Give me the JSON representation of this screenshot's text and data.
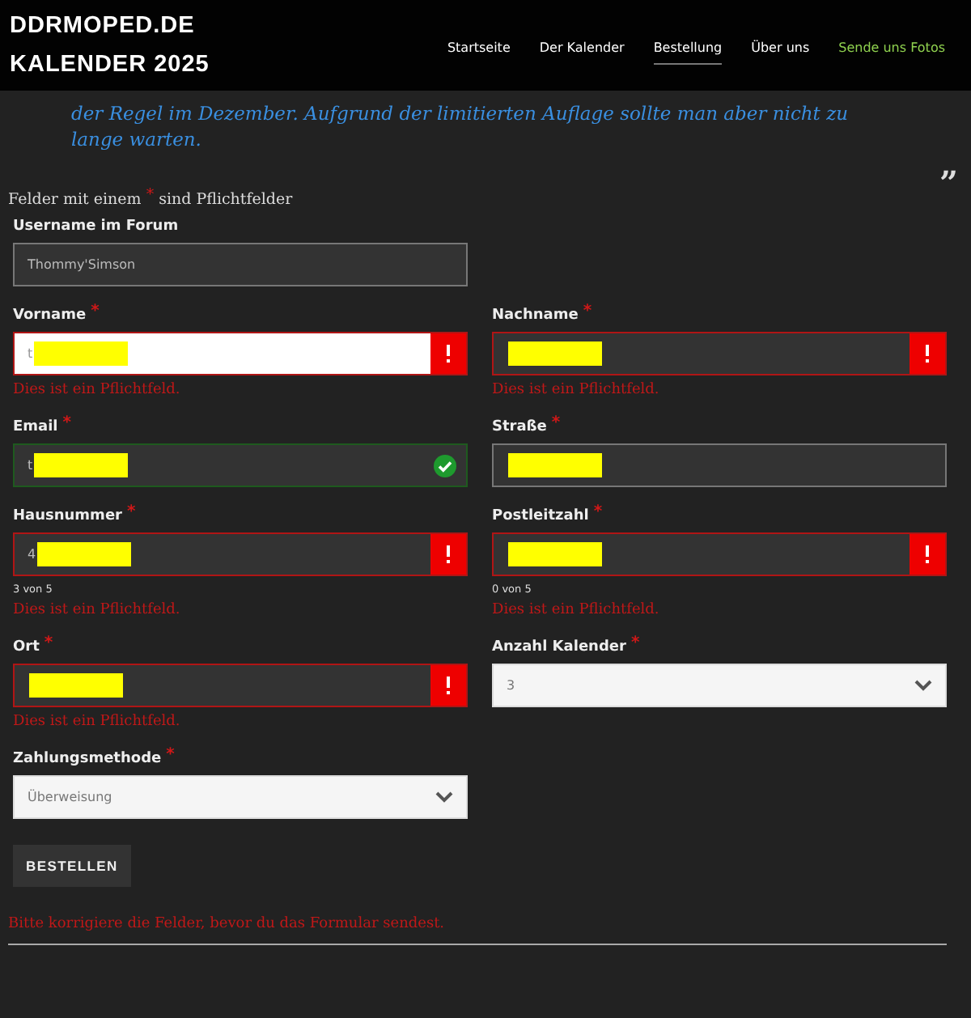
{
  "header": {
    "logo_lines": [
      "DDRMOPED.DE",
      "KALENDER 2025"
    ],
    "nav": [
      {
        "label": "Startseite",
        "selected": false,
        "kind": "link"
      },
      {
        "label": "Der Kalender",
        "selected": false,
        "kind": "link"
      },
      {
        "label": "Bestellung",
        "selected": true,
        "kind": "link"
      },
      {
        "label": "Über uns",
        "selected": false,
        "kind": "link"
      },
      {
        "label": "Sende uns Fotos",
        "selected": false,
        "kind": "cta"
      }
    ]
  },
  "quote": {
    "lines": [
      "der Regel im Dezember. Aufgrund der limitierten Auflage sollte man aber nicht zu",
      "lange warten."
    ],
    "mark": "”"
  },
  "form": {
    "note_before": "Felder mit einem",
    "note_star": "*",
    "note_after": "sind Pflichtfelder",
    "rows": [
      [
        {
          "label": "Username im Forum",
          "required": false,
          "kind": "text",
          "value": "Thommy'Simson",
          "invalid": false,
          "valid": false,
          "redacted": false
        }
      ],
      [
        {
          "label": "Vorname",
          "required": true,
          "kind": "text",
          "value": "t",
          "invalid": true,
          "valid": false,
          "redacted": true,
          "focused": true,
          "error": "Dies ist ein Pflichtfeld."
        },
        {
          "label": "Nachname",
          "required": true,
          "kind": "text",
          "invalid": true,
          "valid": false,
          "redacted": true,
          "focused": false,
          "error": "Dies ist ein Pflichtfeld."
        }
      ],
      [
        {
          "label": "Email",
          "required": true,
          "kind": "text",
          "value": "t",
          "invalid": false,
          "valid": true,
          "redacted": true
        },
        {
          "label": "Straße",
          "required": true,
          "kind": "text",
          "invalid": false,
          "valid": false,
          "redacted": true
        }
      ],
      [
        {
          "label": "Hausnummer",
          "required": true,
          "kind": "text",
          "value": "4",
          "invalid": true,
          "valid": false,
          "redacted": true,
          "focused": false,
          "counter": "3 von 5",
          "error": "Dies ist ein Pflichtfeld."
        },
        {
          "label": "Postleitzahl",
          "required": true,
          "kind": "text",
          "invalid": true,
          "valid": false,
          "redacted": true,
          "focused": false,
          "counter": "0 von 5",
          "error": "Dies ist ein Pflichtfeld."
        }
      ],
      [
        {
          "label": "Ort",
          "required": true,
          "kind": "text",
          "invalid": true,
          "valid": false,
          "redacted": true,
          "focused": false,
          "error": "Dies ist ein Pflichtfeld."
        },
        {
          "label": "Anzahl Kalender",
          "required": true,
          "kind": "select",
          "value": "3",
          "invalid": false,
          "valid": false,
          "redacted": false
        }
      ],
      [
        {
          "label": "Zahlungsmethode",
          "required": true,
          "kind": "select",
          "value": "Überweisung",
          "invalid": false,
          "valid": false,
          "redacted": false
        }
      ]
    ],
    "submit": "BESTELLEN",
    "form_error": "Bitte korrigiere die Felder, bevor du das Formular sendest."
  }
}
